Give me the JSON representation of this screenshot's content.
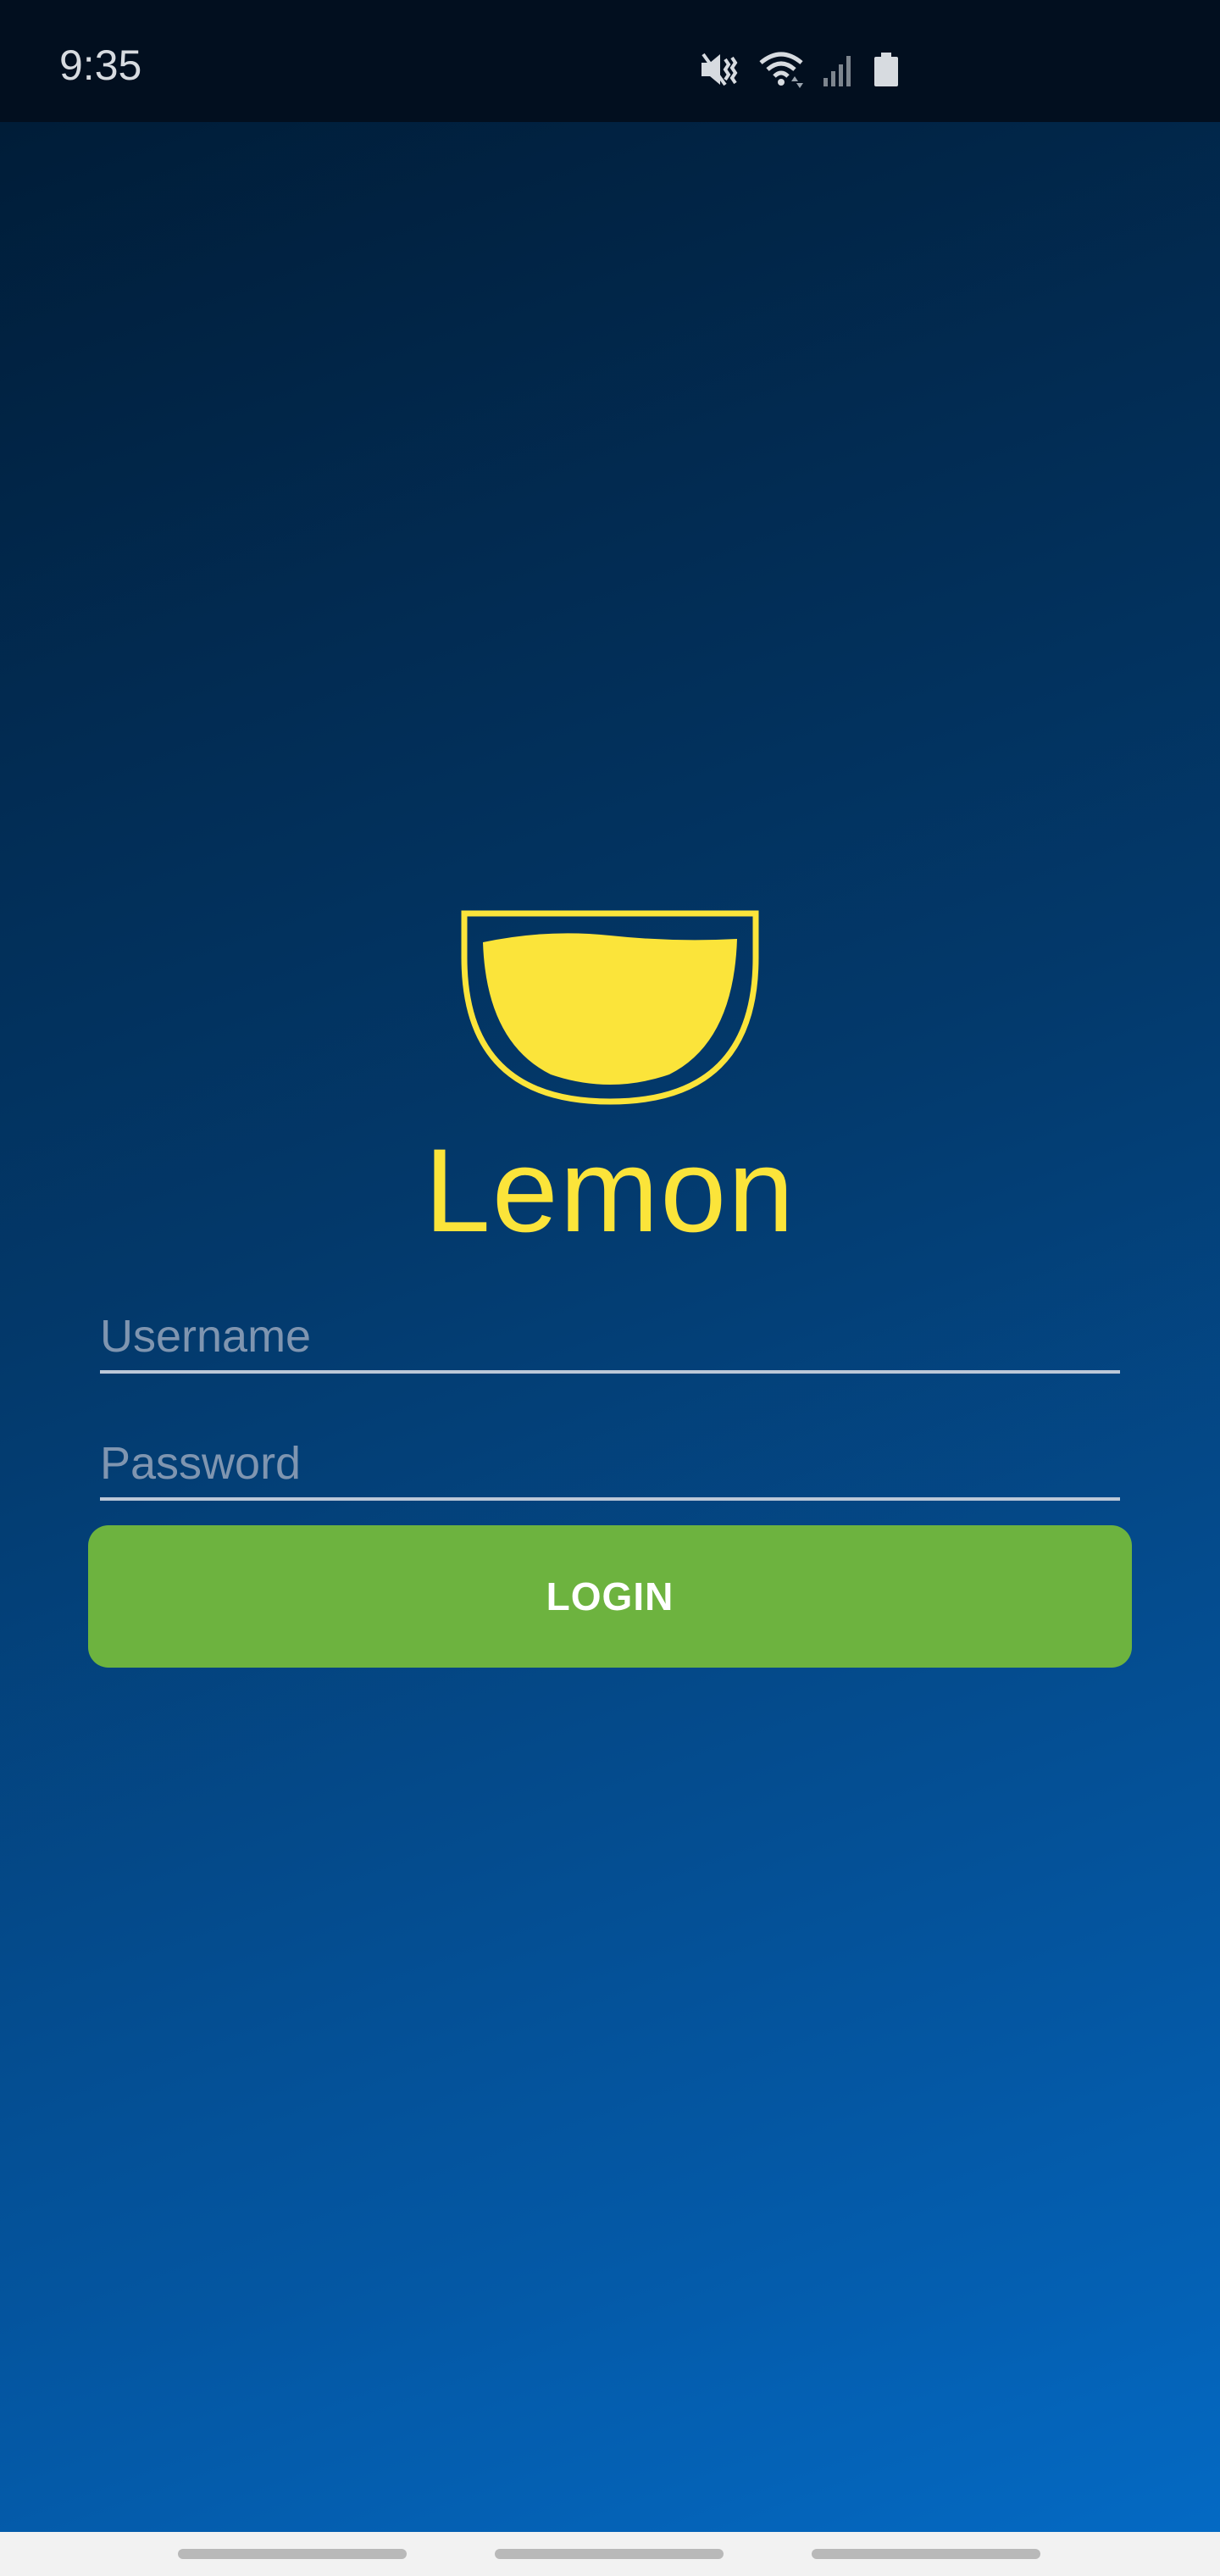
{
  "status_bar": {
    "time": "9:35",
    "icons": [
      "mute-icon",
      "wifi-icon",
      "signal-icon",
      "battery-icon"
    ]
  },
  "app": {
    "name": "Lemon",
    "logo_icon": "lemonade-bowl-icon",
    "brand_color": "#fbe43a"
  },
  "form": {
    "username_placeholder": "Username",
    "password_placeholder": "Password",
    "login_label": "LOGIN",
    "login_color": "#6db33f"
  },
  "nav_bar": {
    "buttons": [
      "recent-apps",
      "home",
      "back"
    ]
  }
}
